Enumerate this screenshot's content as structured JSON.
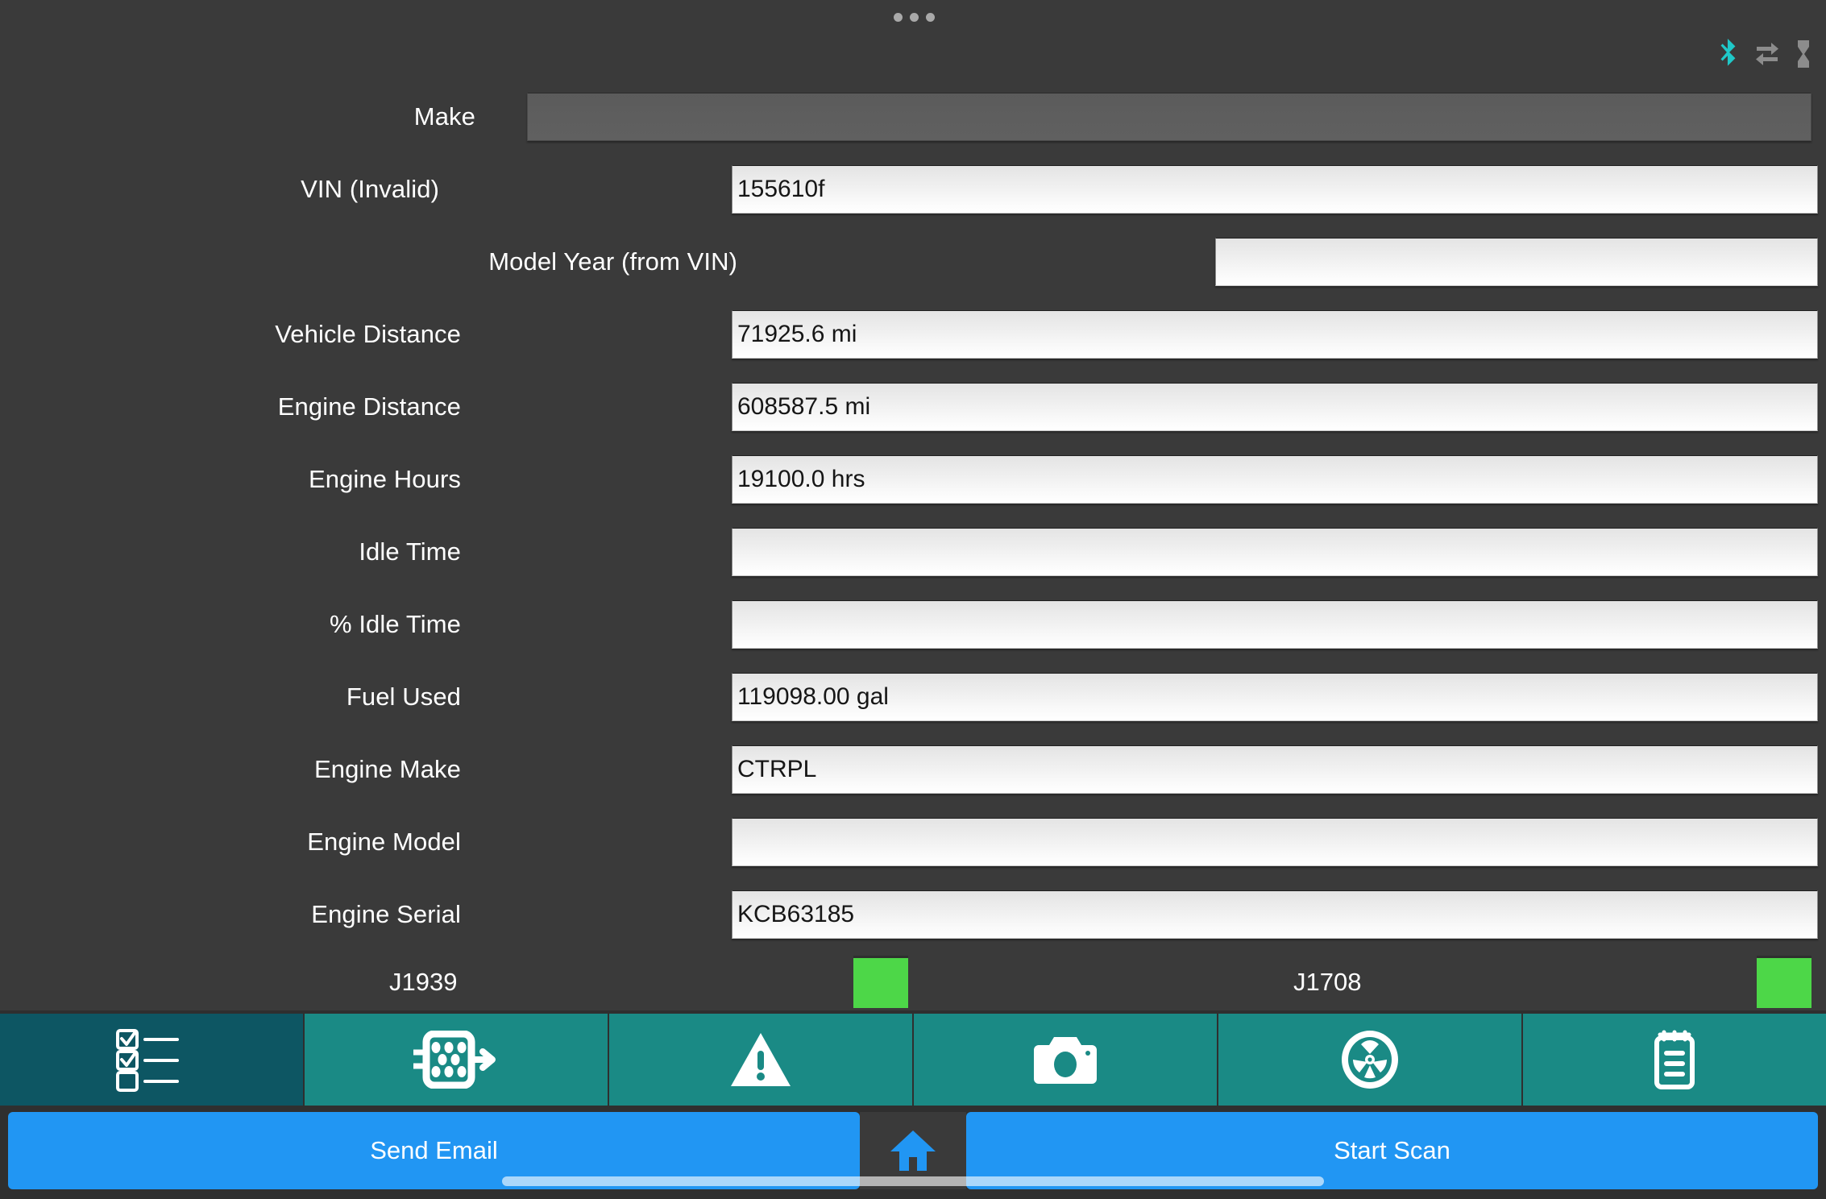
{
  "statusbar": {
    "overflow_menu": "overflow-menu",
    "icons": [
      {
        "name": "bluetooth-icon",
        "color": "#1fc8c8"
      },
      {
        "name": "data-transfer-icon",
        "color": "#8c8c8c"
      },
      {
        "name": "battery-icon",
        "color": "#8c8c8c"
      }
    ]
  },
  "form": {
    "fields": [
      {
        "label": "Make",
        "value": "",
        "placeholder": "",
        "disabled": true,
        "layout": "make"
      },
      {
        "label": "VIN (Invalid)",
        "value": "155610f",
        "placeholder": "",
        "disabled": false,
        "layout": "vin"
      },
      {
        "label": "Model Year (from VIN)",
        "value": "",
        "placeholder": "",
        "disabled": false,
        "layout": "year"
      },
      {
        "label": "Vehicle Distance",
        "value": "71925.6 mi",
        "placeholder": "",
        "disabled": false,
        "layout": "std"
      },
      {
        "label": "Engine Distance",
        "value": "608587.5 mi",
        "placeholder": "",
        "disabled": false,
        "layout": "std"
      },
      {
        "label": "Engine Hours",
        "value": "19100.0 hrs",
        "placeholder": "",
        "disabled": false,
        "layout": "std"
      },
      {
        "label": "Idle Time",
        "value": "",
        "placeholder": "",
        "disabled": false,
        "layout": "std"
      },
      {
        "label": "% Idle Time",
        "value": "",
        "placeholder": "",
        "disabled": false,
        "layout": "std"
      },
      {
        "label": "Fuel Used",
        "value": "119098.00 gal",
        "placeholder": "",
        "disabled": false,
        "layout": "std"
      },
      {
        "label": "Engine Make",
        "value": "CTRPL",
        "placeholder": "",
        "disabled": false,
        "layout": "std"
      },
      {
        "label": "Engine Model",
        "value": "",
        "placeholder": "",
        "disabled": false,
        "layout": "std"
      },
      {
        "label": "Engine Serial",
        "value": "KCB63185",
        "placeholder": "",
        "disabled": false,
        "layout": "std"
      }
    ]
  },
  "protocols": {
    "j1939_label": "J1939",
    "j1939_status_color": "#4dd748",
    "j1708_label": "J1708",
    "j1708_status_color": "#4dd748"
  },
  "tabs": [
    {
      "icon": "checklist-icon",
      "selected": true
    },
    {
      "icon": "connector-icon",
      "selected": false
    },
    {
      "icon": "warning-icon",
      "selected": false
    },
    {
      "icon": "camera-icon",
      "selected": false
    },
    {
      "icon": "wheel-icon",
      "selected": false
    },
    {
      "icon": "notepad-icon",
      "selected": false
    }
  ],
  "bottombar": {
    "send_email_label": "Send Email",
    "home_icon": "home-icon",
    "start_scan_label": "Start Scan",
    "accent_color": "#2196f3"
  }
}
